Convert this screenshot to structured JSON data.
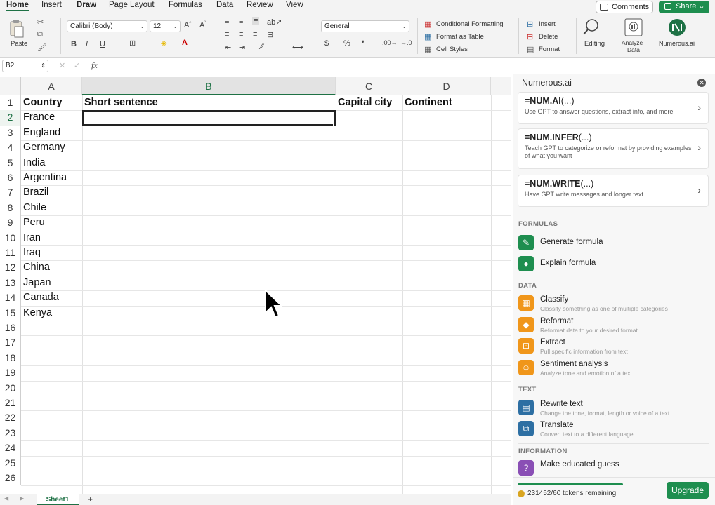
{
  "ribbon_tabs": [
    "Home",
    "Insert",
    "Draw",
    "Page Layout",
    "Formulas",
    "Data",
    "Review",
    "View"
  ],
  "comments_label": "Comments",
  "share_label": "Share",
  "ribbon": {
    "paste_label": "Paste",
    "font_name": "Calibri (Body)",
    "font_size": "12",
    "number_format": "General",
    "conditional_formatting": "Conditional Formatting",
    "format_as_table": "Format as Table",
    "cell_styles": "Cell Styles",
    "insert": "Insert",
    "delete": "Delete",
    "format": "Format",
    "editing": "Editing",
    "analyze_data_1": "Analyze",
    "analyze_data_2": "Data",
    "numerous": "Numerous.ai"
  },
  "formula_bar": {
    "name_box": "B2",
    "fx": "fx"
  },
  "grid": {
    "columns": [
      "A",
      "B",
      "C",
      "D"
    ],
    "rows": [
      "1",
      "2",
      "3",
      "4",
      "5",
      "6",
      "7",
      "8",
      "9",
      "10",
      "11",
      "12",
      "13",
      "14",
      "15",
      "16",
      "17",
      "18",
      "19",
      "20",
      "21",
      "22",
      "23",
      "24",
      "25",
      "26"
    ],
    "header_row": [
      "Country",
      "Short sentence",
      "Capital city",
      "Continent"
    ],
    "countries": [
      "France",
      "England",
      "Germany",
      "India",
      "Argentina",
      "Brazil",
      "Chile",
      "Peru",
      "Iran",
      "Iraq",
      "China",
      "Japan",
      "Canada",
      "Kenya"
    ]
  },
  "sheet_tab": "Sheet1",
  "panel": {
    "title": "Numerous.ai",
    "cards": [
      {
        "fn": "=NUM.AI",
        "args": "(...)",
        "desc": "Use GPT to answer questions, extract info, and more"
      },
      {
        "fn": "=NUM.INFER",
        "args": "(...)",
        "desc": "Teach GPT to categorize or reformat by providing examples of what you want"
      },
      {
        "fn": "=NUM.WRITE",
        "args": "(...)",
        "desc": "Have GPT write messages and longer text"
      }
    ],
    "formulas_section": "FORMULAS",
    "generate_formula": "Generate formula",
    "explain_formula": "Explain formula",
    "data_section": "DATA",
    "data_items": [
      {
        "label": "Classify",
        "sub": "Classify something as one of multiple categories"
      },
      {
        "label": "Reformat",
        "sub": "Reformat data to your desired format"
      },
      {
        "label": "Extract",
        "sub": "Pull specific information from text"
      },
      {
        "label": "Sentiment analysis",
        "sub": "Analyze tone and emotion of a text"
      }
    ],
    "text_section": "TEXT",
    "text_items": [
      {
        "label": "Rewrite text",
        "sub": "Change the tone, format, length or voice of a text"
      },
      {
        "label": "Translate",
        "sub": "Convert text to a different language"
      }
    ],
    "info_section": "INFORMATION",
    "educated_guess": "Make educated guess",
    "tokens": "231452/60 tokens remaining",
    "upgrade": "Upgrade"
  }
}
